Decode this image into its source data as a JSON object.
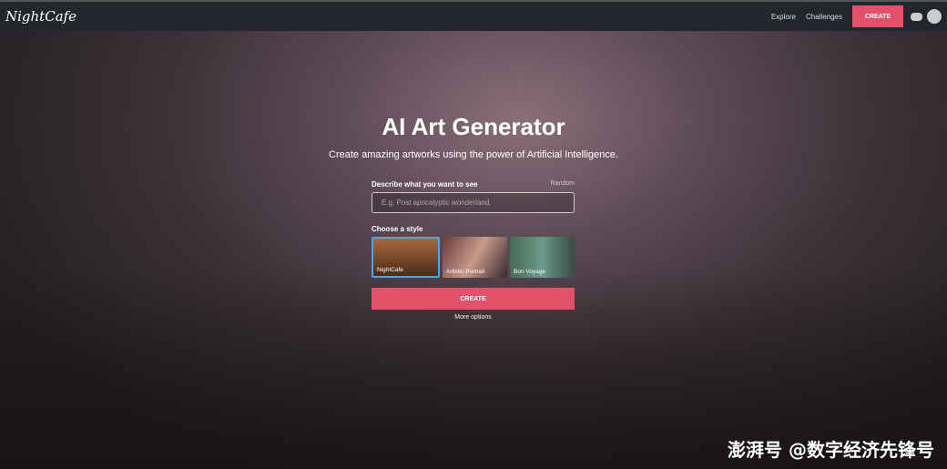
{
  "header": {
    "logo": "NightCafe",
    "nav": [
      "Explore",
      "Challenges"
    ],
    "create": "CREATE"
  },
  "hero": {
    "title": "AI Art Generator",
    "subtitle": "Create amazing artworks using the power of Artificial Intelligence."
  },
  "form": {
    "prompt_label": "Describe what you want to see",
    "random": "Random",
    "placeholder": "E.g. Post apocalyptic wonderland.",
    "style_label": "Choose a style",
    "styles": [
      "NightCafe",
      "Artistic Portrait",
      "Bon Voyage"
    ],
    "create": "CREATE",
    "more": "More options"
  },
  "watermark": "澎湃号 @数字经济先锋号"
}
